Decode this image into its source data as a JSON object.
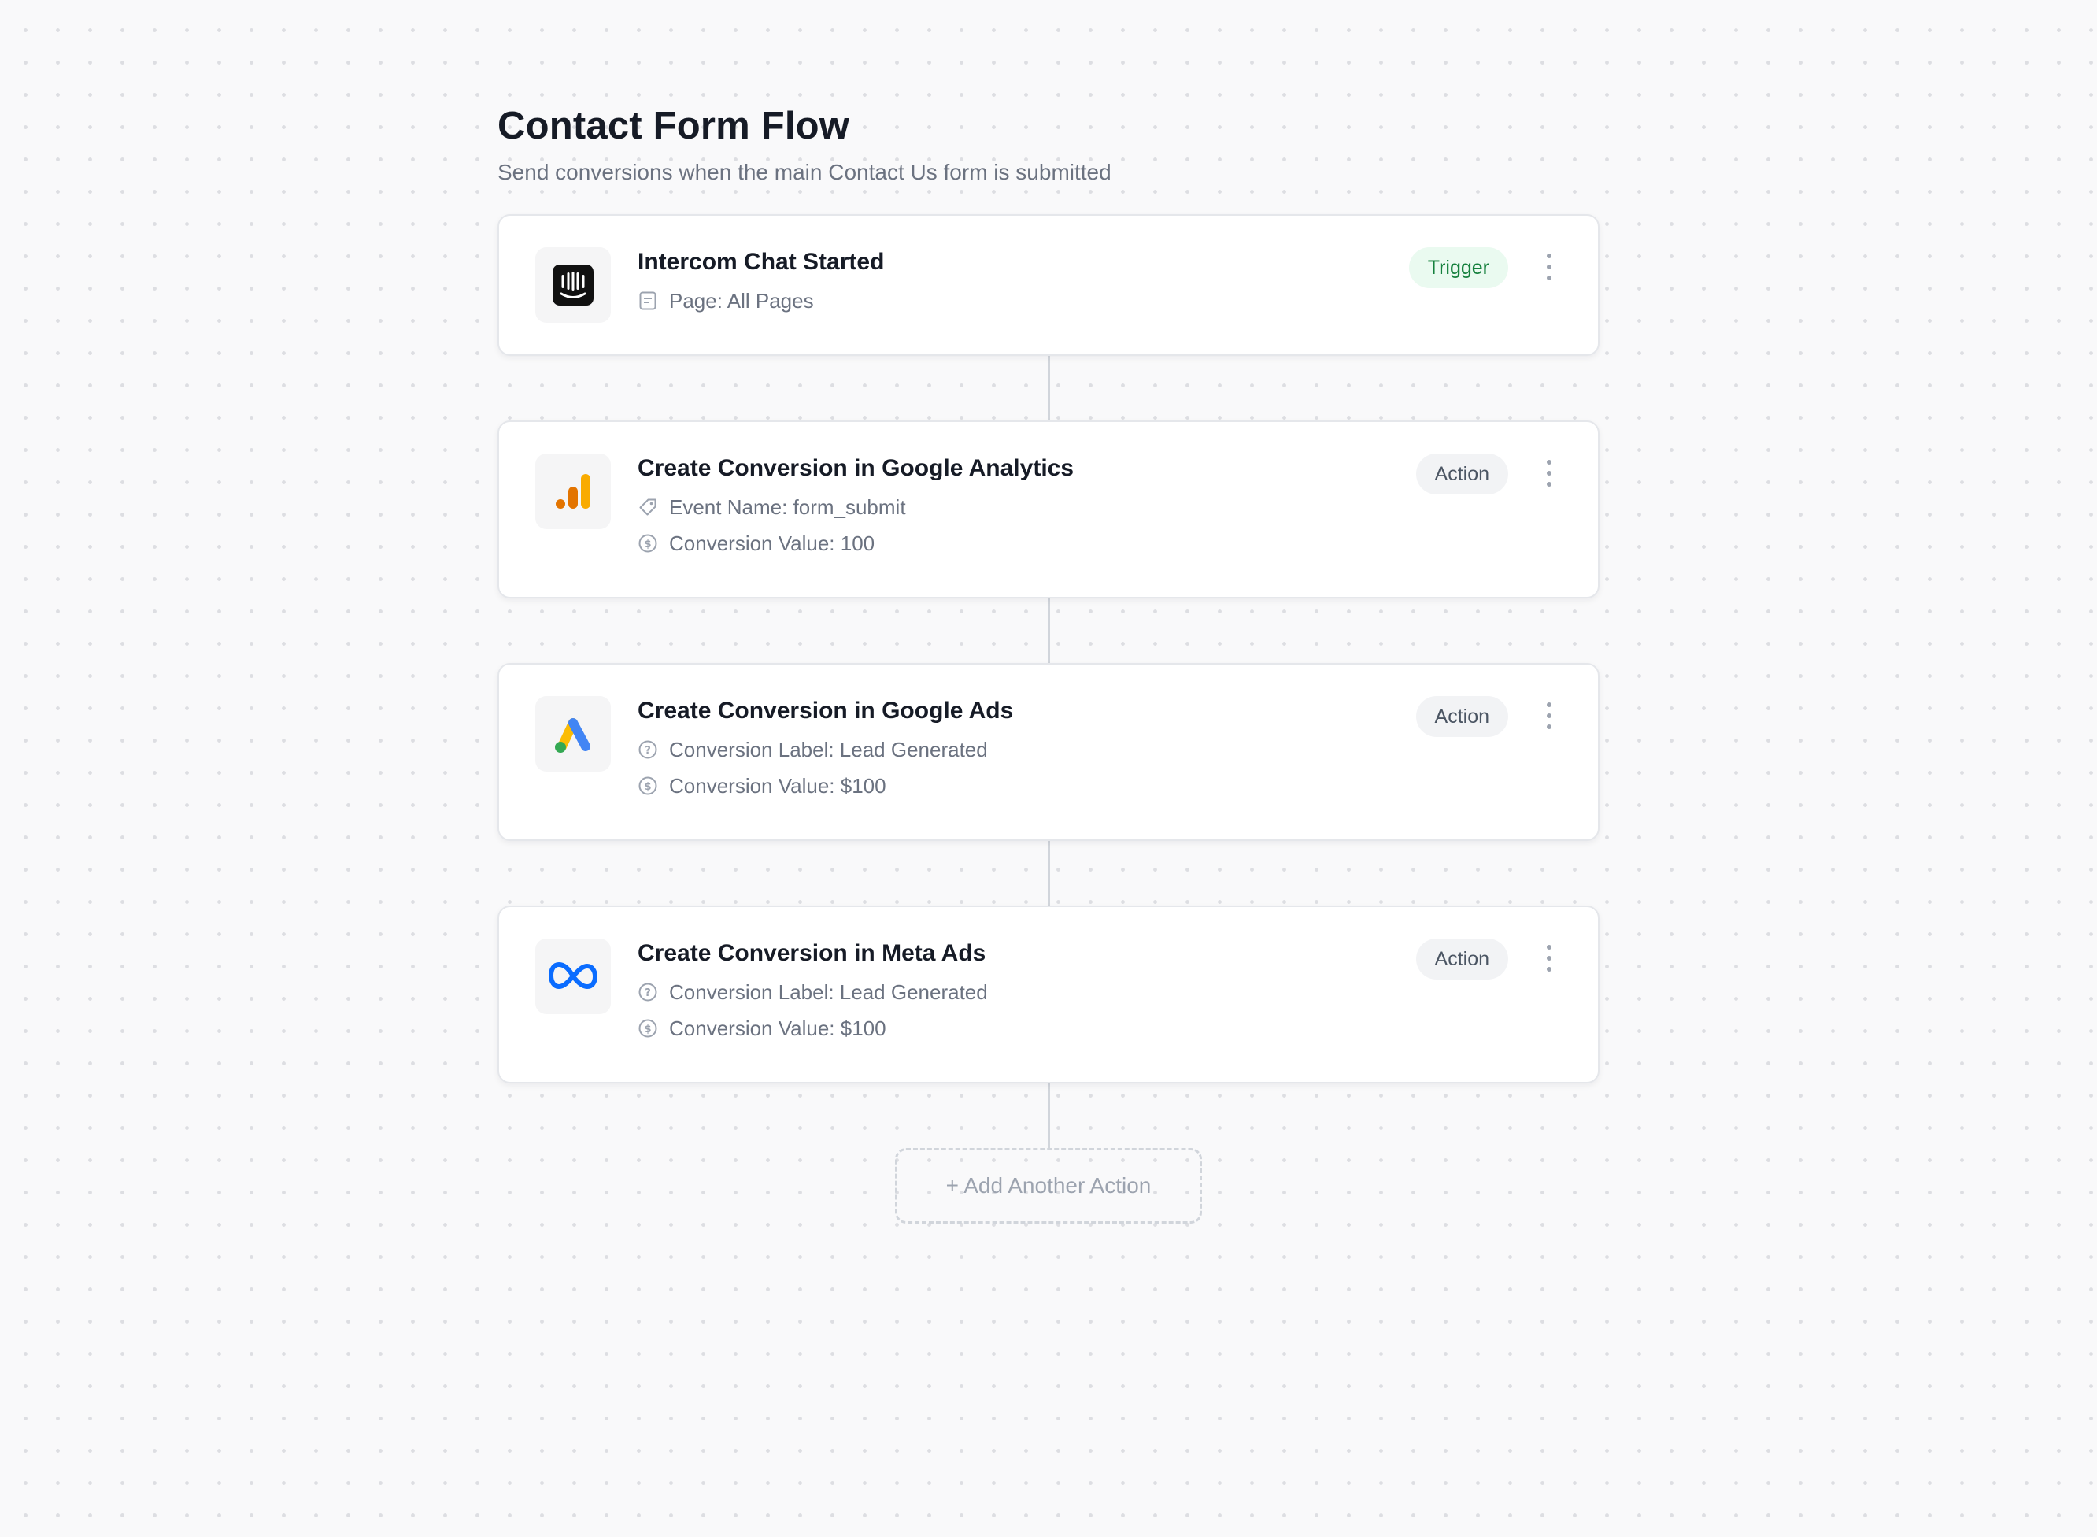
{
  "header": {
    "title": "Contact Form Flow",
    "subtitle": "Send conversions when the main Contact Us form is submitted"
  },
  "steps": [
    {
      "title": "Intercom Chat Started",
      "badge": "Trigger",
      "logo": "intercom-logo",
      "meta": [
        {
          "icon": "page-icon",
          "text": "Page: All Pages"
        }
      ]
    },
    {
      "title": "Create Conversion in Google Analytics",
      "badge": "Action",
      "logo": "google-analytics-logo",
      "meta": [
        {
          "icon": "tag-icon",
          "text": "Event Name: form_submit"
        },
        {
          "icon": "dollar-circle-icon",
          "text": "Conversion Value: 100"
        }
      ]
    },
    {
      "title": "Create Conversion in Google Ads",
      "badge": "Action",
      "logo": "google-ads-logo",
      "meta": [
        {
          "icon": "question-circle-icon",
          "text": "Conversion Label: Lead Generated"
        },
        {
          "icon": "dollar-circle-icon",
          "text": "Conversion Value: $100"
        }
      ]
    },
    {
      "title": "Create Conversion in Meta Ads",
      "badge": "Action",
      "logo": "meta-logo",
      "meta": [
        {
          "icon": "question-circle-icon",
          "text": "Conversion Label: Lead Generated"
        },
        {
          "icon": "dollar-circle-icon",
          "text": "Conversion Value: $100"
        }
      ]
    }
  ],
  "add_action_label": "+ Add Another Action",
  "colors": {
    "trigger_badge_bg": "#eafaf0",
    "trigger_badge_text": "#15803d",
    "action_badge_bg": "#f2f3f5",
    "meta_blue": "#0a6cff",
    "ga_orange_dark": "#e37400",
    "ga_orange_light": "#f9ab00",
    "ads_blue": "#4285f4",
    "ads_yellow": "#fbbc04",
    "ads_green": "#34a853"
  }
}
